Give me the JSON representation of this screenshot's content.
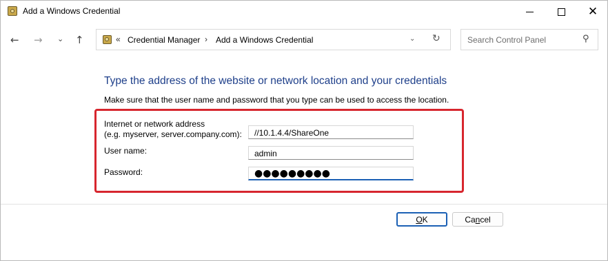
{
  "window": {
    "title": "Add a Windows Credential",
    "controls": {
      "minimize": "minimize-icon",
      "maximize": "maximize-icon",
      "close": "close-icon"
    }
  },
  "nav": {
    "back_icon": "←",
    "forward_icon": "→",
    "recent_icon": "⌄",
    "up_icon": "↑",
    "breadcrumb": {
      "more": "«",
      "items": [
        "Credential Manager",
        "Add a Windows Credential"
      ],
      "separator": "›"
    },
    "dropdown_icon": "⌄",
    "refresh_icon": "↻",
    "search_placeholder": "Search Control Panel",
    "search_icon": "⚲"
  },
  "content": {
    "heading": "Type the address of the website or network location and your credentials",
    "subtext": "Make sure that the user name and password that you type can be used to access the location.",
    "address_label_line1": "Internet or network address",
    "address_label_line2": "(e.g. myserver, server.company.com):",
    "address_value": "//10.1.4.4/ShareOne",
    "username_label": "User name:",
    "username_value": "admin",
    "password_label": "Password:",
    "password_mask": "●●●●●●●●●",
    "highlight_color": "#d7262e"
  },
  "buttons": {
    "ok_label": "OK",
    "ok_mnemonic": "O",
    "ok_rest": "K",
    "cancel_label": "Cancel",
    "cancel_mnemonic": "n",
    "cancel_pre": "Ca",
    "cancel_post": "cel"
  },
  "colors": {
    "heading": "#1e3f8a",
    "accent": "#1a5fb4"
  }
}
